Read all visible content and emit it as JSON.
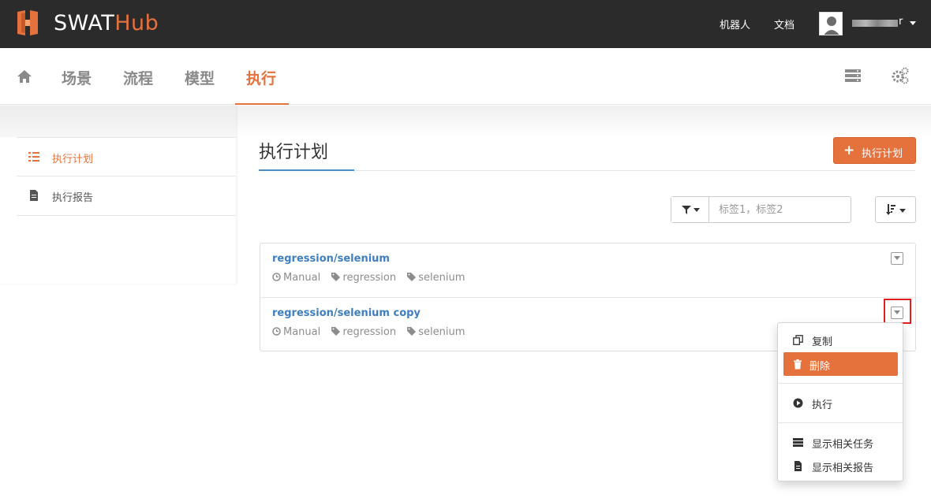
{
  "app": {
    "brand_part1": "SWAT",
    "brand_part2": "Hub",
    "brand_color": "#e5723d"
  },
  "topbar": {
    "links": [
      "机器人",
      "文档"
    ],
    "user_name_visible_suffix": "r"
  },
  "nav": {
    "tabs": [
      {
        "label": "场景",
        "active": false
      },
      {
        "label": "流程",
        "active": false
      },
      {
        "label": "模型",
        "active": false
      },
      {
        "label": "执行",
        "active": true
      }
    ],
    "icons": [
      "home-icon",
      "server-list-icon",
      "settings-gears-icon"
    ]
  },
  "sidebar": {
    "items": [
      {
        "label": "执行计划",
        "icon": "list-icon",
        "active": true
      },
      {
        "label": "执行报告",
        "icon": "file-icon",
        "active": false
      }
    ]
  },
  "main": {
    "title": "执行计划",
    "add_button_label": "执行计划",
    "filter_placeholder": "标签1，标签2",
    "plans": [
      {
        "name": "regression/selenium",
        "trigger": "Manual",
        "tags": [
          "regression",
          "selenium"
        ]
      },
      {
        "name": "regression/selenium copy",
        "trigger": "Manual",
        "tags": [
          "regression",
          "selenium"
        ]
      }
    ]
  },
  "dropdown": {
    "items": [
      {
        "label": "复制",
        "icon": "copy-icon",
        "active": false
      },
      {
        "label": "删除",
        "icon": "trash-icon",
        "active": true
      },
      {
        "label": "执行",
        "icon": "play-icon",
        "active": false
      },
      {
        "label": "显示相关任务",
        "icon": "server-list-icon",
        "active": false
      },
      {
        "label": "显示相关报告",
        "icon": "file-icon",
        "active": false
      }
    ]
  }
}
